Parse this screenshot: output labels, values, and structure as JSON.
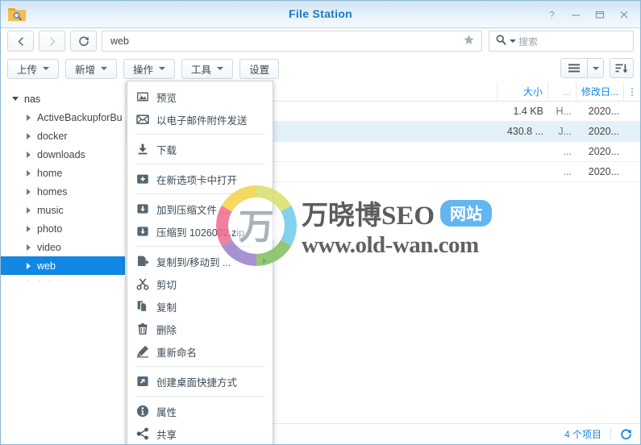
{
  "window": {
    "title": "File Station",
    "app_icon": "folder-search-icon",
    "controls": [
      {
        "name": "help",
        "glyph": "?"
      },
      {
        "name": "minimize",
        "glyph": "–"
      },
      {
        "name": "maximize",
        "glyph": "□"
      },
      {
        "name": "close",
        "glyph": "✕"
      }
    ]
  },
  "nav": {
    "back_icon": "chevron-left-icon",
    "forward_icon": "chevron-right-icon",
    "refresh_icon": "refresh-icon",
    "path_value": "web",
    "path_placeholder": "",
    "favorite_icon": "star-icon",
    "search_placeholder": "搜索",
    "search_value": "",
    "search_icon": "search-icon"
  },
  "toolbar": {
    "buttons": [
      {
        "label": "上传",
        "has_caret": true,
        "name": "upload-button"
      },
      {
        "label": "新增",
        "has_caret": true,
        "name": "create-button"
      },
      {
        "label": "操作",
        "has_caret": true,
        "name": "action-button"
      },
      {
        "label": "工具",
        "has_caret": true,
        "name": "tools-button"
      },
      {
        "label": "设置",
        "has_caret": false,
        "name": "settings-button"
      }
    ],
    "view_icon": "list-view-icon",
    "view_caret": "chevron-down-icon",
    "sort_icon": "sort-descending-icon"
  },
  "sidebar": {
    "root": {
      "label": "nas",
      "expanded": true
    },
    "items": [
      {
        "label": "ActiveBackupforBu",
        "selected": false
      },
      {
        "label": "docker",
        "selected": false
      },
      {
        "label": "downloads",
        "selected": false
      },
      {
        "label": "home",
        "selected": false
      },
      {
        "label": "homes",
        "selected": false
      },
      {
        "label": "music",
        "selected": false
      },
      {
        "label": "photo",
        "selected": false
      },
      {
        "label": "video",
        "selected": false
      },
      {
        "label": "web",
        "selected": true
      }
    ],
    "ghost": "· · · ·"
  },
  "table": {
    "headers": {
      "name": "",
      "size": "大小",
      "type": "...",
      "date": "修改日...",
      "more": "⋮"
    },
    "rows": [
      {
        "name": "",
        "size": "1.4 KB",
        "type": "H...",
        "date": "2020...",
        "selected": false
      },
      {
        "name": "",
        "size": "430.8 ...",
        "type": "J...",
        "date": "2020...",
        "selected": true
      },
      {
        "name": "",
        "size": "",
        "type": "...",
        "date": "2020...",
        "selected": false
      },
      {
        "name": "",
        "size": "",
        "type": "...",
        "date": "2020...",
        "selected": false
      }
    ]
  },
  "context_menu": {
    "items": [
      {
        "label": "预览",
        "icon": "preview-image-icon",
        "type": "item"
      },
      {
        "label": "以电子邮件附件发送",
        "icon": "email-icon",
        "type": "item"
      },
      {
        "type": "separator"
      },
      {
        "label": "下载",
        "icon": "download-icon",
        "type": "item"
      },
      {
        "type": "separator"
      },
      {
        "label": "在新选项卡中打开",
        "icon": "open-new-tab-icon",
        "type": "item"
      },
      {
        "type": "separator"
      },
      {
        "label": "加到压缩文件 ...",
        "icon": "archive-add-icon",
        "type": "item"
      },
      {
        "label": "压缩到 1026002.zip",
        "icon": "archive-zip-icon",
        "type": "item"
      },
      {
        "type": "separator"
      },
      {
        "label": "复制到/移动到 ...",
        "icon": "copy-move-icon",
        "type": "item",
        "submenu": true
      },
      {
        "label": "剪切",
        "icon": "cut-scissors-icon",
        "type": "item"
      },
      {
        "label": "复制",
        "icon": "copy-icon",
        "type": "item"
      },
      {
        "label": "删除",
        "icon": "trash-icon",
        "type": "item"
      },
      {
        "label": "重新命名",
        "icon": "rename-pencil-icon",
        "type": "item"
      },
      {
        "type": "separator"
      },
      {
        "label": "创建桌面快捷方式",
        "icon": "desktop-shortcut-icon",
        "type": "item"
      },
      {
        "type": "separator"
      },
      {
        "label": "属性",
        "icon": "info-icon",
        "type": "item"
      },
      {
        "label": "共享",
        "icon": "share-icon",
        "type": "item"
      }
    ]
  },
  "statusbar": {
    "count": "4 个项目",
    "refresh_icon": "refresh-icon"
  },
  "watermark": {
    "brand": "万晓博SEO",
    "badge": "网站",
    "url": "www.old-wan.com",
    "ring_icon": "color-ring-logo"
  },
  "colors": {
    "accent": "#1287e3",
    "title_text": "#1878c8",
    "selection": "#1287e3",
    "row_selection": "#e3f1fb",
    "badge": "#62b5f0"
  }
}
